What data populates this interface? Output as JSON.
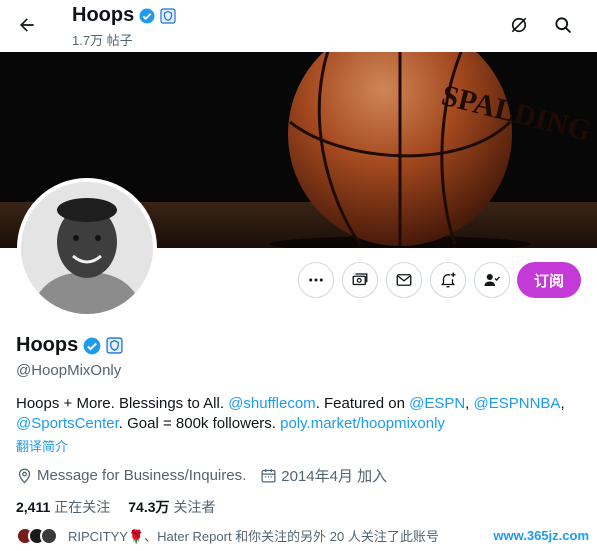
{
  "header": {
    "title": "Hoops",
    "post_count": "1.7万 帖子"
  },
  "profile": {
    "name": "Hoops",
    "handle": "@HoopMixOnly",
    "bio": {
      "p1": "Hoops + More. Blessings to All. ",
      "m1": "@shufflecom",
      "p2": ". Featured on ",
      "m2": "@ESPN",
      "p3": ", ",
      "m3": "@ESPNNBA",
      "p4": ", ",
      "m4": "@SportsCenter",
      "p5": ". Goal = 800k followers. ",
      "m5": "poly.market/hoopmixonly"
    },
    "translate_label": "翻译简介",
    "location": "Message for Business/Inquires.",
    "joined": "2014年4月 加入",
    "following_count": "2,411",
    "following_label": "正在关注",
    "followers_count": "74.3万",
    "followers_label": "关注者",
    "followed_by": "RIPCITYY🌹、Hater Report 和你关注的另外 20 人关注了此账号"
  },
  "actions": {
    "subscribe_label": "订阅"
  },
  "banner": {
    "ball_text": "SPALDING"
  },
  "watermark": "www.365jz.com",
  "colors": {
    "accent": "#1d9bf0",
    "subscribe": "#c43ad6",
    "verified": "#1d9bf0"
  }
}
